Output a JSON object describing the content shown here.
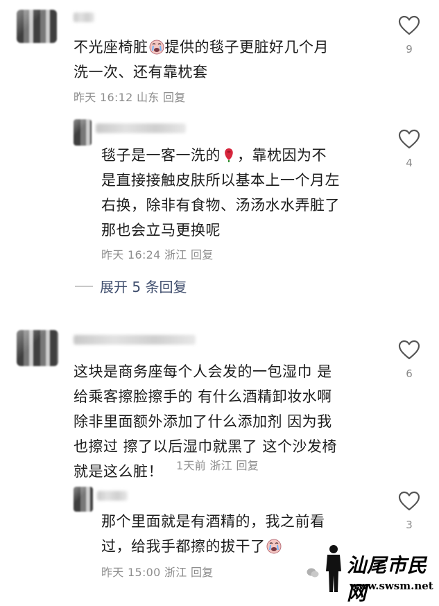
{
  "comments": [
    {
      "text_part1": "不光座椅脏",
      "text_part2": "提供的毯子更脏好几个月\n洗一次、还有靠枕套",
      "meta": "昨天 16:12 山东  回复",
      "likes": "9"
    },
    {
      "text_part1": "毯子是一客一洗的",
      "text_part2": "，靠枕因为不\n是直接接触皮肤所以基本上一个月左\n右换，除非有食物、汤汤水水弄脏了\n那也会立马更换呢",
      "meta": "昨天 16:24 浙江  回复",
      "likes": "4"
    },
    {
      "text": "这块是商务座每个人会发的一包湿巾 是\n给乘客擦脸擦手的 有什么酒精卸妆水啊\n除非里面额外添加了什么添加剂 因为我\n也擦过 擦了以后湿巾就黑了 这个沙发椅\n就是这么脏！",
      "meta": "1天前  浙江  回复",
      "likes": "6"
    },
    {
      "text_part1": "那个里面就是有酒精的，我之前看\n过，给我手都擦的拔干了",
      "meta": "昨天 15:00 浙江  回复",
      "likes": "3"
    }
  ],
  "expand_replies": "展开 5 条回复",
  "watermark": {
    "title": "汕尾市民网",
    "url": "www.swsm.net"
  },
  "icons": {
    "like": "heart-outline-icon",
    "emoji_cry": "crying-face-emoji",
    "emoji_rose": "rose-emoji",
    "wechat": "wechat-icon"
  },
  "colors": {
    "text": "#1c1c1c",
    "meta": "#8d8d8d",
    "expand": "#3c4b6b"
  }
}
